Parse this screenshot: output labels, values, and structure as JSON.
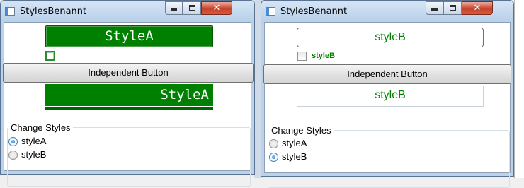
{
  "left_window": {
    "title": "StylesBenannt",
    "styled_button_text": "StyleA",
    "independent_button_label": "Independent Button",
    "styled_textbox_text": "StyleA",
    "group_title": "Change Styles",
    "radio_options": [
      "styleA",
      "styleB"
    ],
    "selected": "styleA"
  },
  "right_window": {
    "title": "StylesBenannt",
    "styled_button_text": "styleB",
    "checkbox_label": "styleB",
    "independent_button_label": "Independent Button",
    "styled_textbox_text": "styleB",
    "group_title": "Change Styles",
    "radio_options": [
      "styleA",
      "styleB"
    ],
    "selected": "styleB"
  },
  "colors": {
    "style_green": "#008000",
    "title_bar": "#bcd2ea",
    "close_button": "#c6432c"
  }
}
